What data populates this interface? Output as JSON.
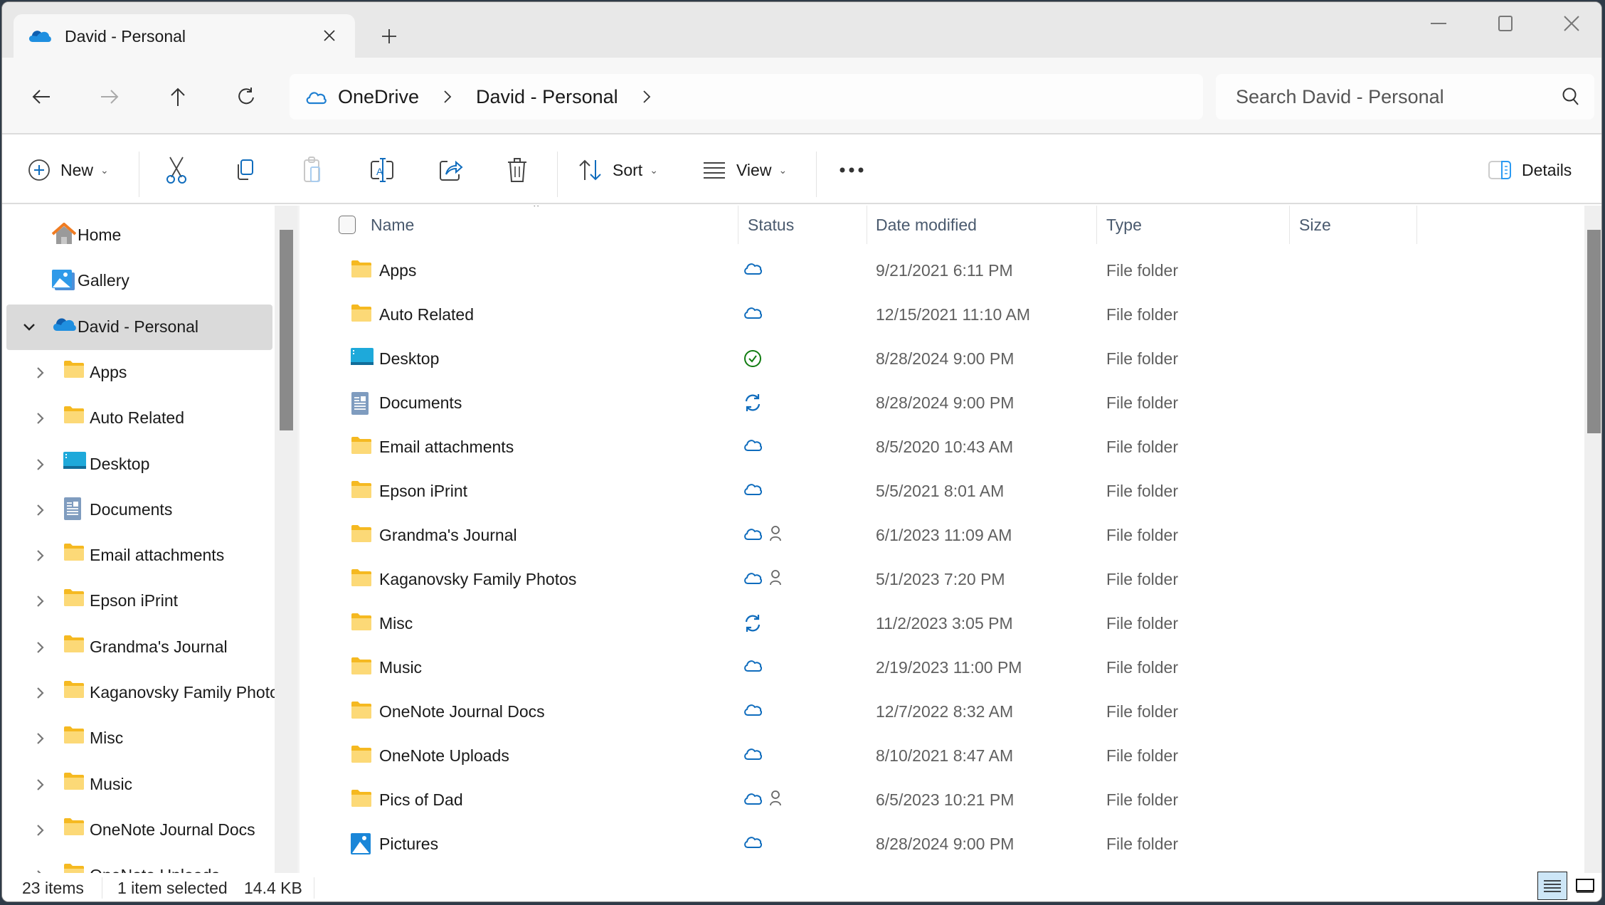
{
  "window": {
    "tab_title": "David - Personal",
    "controls": {
      "minimize": "minimize",
      "maximize": "maximize",
      "close": "close"
    }
  },
  "address": {
    "breadcrumbs": [
      "OneDrive",
      "David - Personal"
    ],
    "search_placeholder": "Search David - Personal"
  },
  "toolbar": {
    "new_label": "New",
    "sort_label": "Sort",
    "view_label": "View",
    "details_label": "Details",
    "icons": [
      "cut-icon",
      "copy-icon",
      "paste-icon",
      "rename-icon",
      "share-icon",
      "delete-icon"
    ],
    "accent_color": "#0f6cbd"
  },
  "sidebar": {
    "items": [
      {
        "label": "Home",
        "icon": "home-icon"
      },
      {
        "label": "Gallery",
        "icon": "gallery-icon"
      },
      {
        "label": "David - Personal",
        "icon": "onedrive-icon",
        "expanded": true,
        "selected": true
      },
      {
        "label": "Apps",
        "icon": "folder-icon"
      },
      {
        "label": "Auto Related",
        "icon": "folder-icon"
      },
      {
        "label": "Desktop",
        "icon": "desktop-icon"
      },
      {
        "label": "Documents",
        "icon": "documents-icon"
      },
      {
        "label": "Email attachments",
        "icon": "folder-icon"
      },
      {
        "label": "Epson iPrint",
        "icon": "folder-icon"
      },
      {
        "label": "Grandma's Journal",
        "icon": "folder-icon"
      },
      {
        "label": "Kaganovsky Family Photos",
        "icon": "folder-icon"
      },
      {
        "label": "Misc",
        "icon": "folder-icon"
      },
      {
        "label": "Music",
        "icon": "folder-icon"
      },
      {
        "label": "OneNote Journal Docs",
        "icon": "folder-icon"
      },
      {
        "label": "OneNote Uploads",
        "icon": "folder-icon"
      }
    ]
  },
  "list": {
    "columns": [
      "Name",
      "Status",
      "Date modified",
      "Type",
      "Size"
    ],
    "rows": [
      {
        "name": "Apps",
        "icon": "folder-icon",
        "status": "cloud",
        "shared": false,
        "date": "9/21/2021 6:11 PM",
        "type": "File folder",
        "size": ""
      },
      {
        "name": "Auto Related",
        "icon": "folder-icon",
        "status": "cloud",
        "shared": false,
        "date": "12/15/2021 11:10 AM",
        "type": "File folder",
        "size": ""
      },
      {
        "name": "Desktop",
        "icon": "desktop-icon",
        "status": "synced",
        "shared": false,
        "date": "8/28/2024 9:00 PM",
        "type": "File folder",
        "size": ""
      },
      {
        "name": "Documents",
        "icon": "documents-icon",
        "status": "syncing",
        "shared": false,
        "date": "8/28/2024 9:00 PM",
        "type": "File folder",
        "size": ""
      },
      {
        "name": "Email attachments",
        "icon": "folder-icon",
        "status": "cloud",
        "shared": false,
        "date": "8/5/2020 10:43 AM",
        "type": "File folder",
        "size": ""
      },
      {
        "name": "Epson iPrint",
        "icon": "folder-icon",
        "status": "cloud",
        "shared": false,
        "date": "5/5/2021 8:01 AM",
        "type": "File folder",
        "size": ""
      },
      {
        "name": "Grandma's Journal",
        "icon": "folder-icon",
        "status": "cloud",
        "shared": true,
        "date": "6/1/2023 11:09 AM",
        "type": "File folder",
        "size": ""
      },
      {
        "name": "Kaganovsky Family Photos",
        "icon": "folder-icon",
        "status": "cloud",
        "shared": true,
        "date": "5/1/2023 7:20 PM",
        "type": "File folder",
        "size": ""
      },
      {
        "name": "Misc",
        "icon": "folder-icon",
        "status": "syncing",
        "shared": false,
        "date": "11/2/2023 3:05 PM",
        "type": "File folder",
        "size": ""
      },
      {
        "name": "Music",
        "icon": "folder-icon",
        "status": "cloud",
        "shared": false,
        "date": "2/19/2023 11:00 PM",
        "type": "File folder",
        "size": ""
      },
      {
        "name": "OneNote Journal Docs",
        "icon": "folder-icon",
        "status": "cloud",
        "shared": false,
        "date": "12/7/2022 8:32 AM",
        "type": "File folder",
        "size": ""
      },
      {
        "name": "OneNote Uploads",
        "icon": "folder-icon",
        "status": "cloud",
        "shared": false,
        "date": "8/10/2021 8:47 AM",
        "type": "File folder",
        "size": ""
      },
      {
        "name": "Pics of Dad",
        "icon": "folder-icon",
        "status": "cloud",
        "shared": true,
        "date": "6/5/2023 10:21 PM",
        "type": "File folder",
        "size": ""
      },
      {
        "name": "Pictures",
        "icon": "pictures-icon",
        "status": "cloud",
        "shared": false,
        "date": "8/28/2024 9:00 PM",
        "type": "File folder",
        "size": ""
      }
    ]
  },
  "statusbar": {
    "item_count": "23 items",
    "selection": "1 item selected",
    "selection_size": "14.4 KB"
  },
  "colors": {
    "cloud_status": "#0f6cbd",
    "synced_status": "#107c10",
    "folder_yellow": "#f8c948"
  }
}
